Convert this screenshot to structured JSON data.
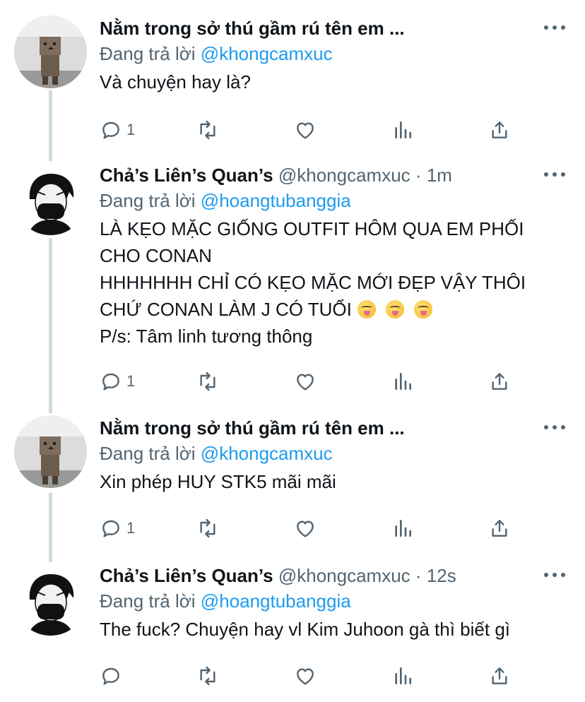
{
  "tweets": [
    {
      "name": "Nằm trong sở thú gầm rú tên em ...",
      "handle": "",
      "time": "",
      "reply_prefix": "Đang trả lời",
      "reply_mention": "@khongcamxuc",
      "lines": [
        "Và chuyện hay là?"
      ],
      "reply_count": "1",
      "avatar": "danbo-avatar"
    },
    {
      "name": "Chả’s Liên’s Quan’s",
      "handle": "@khongcamxuc",
      "time": "1m",
      "reply_prefix": "Đang trả lời",
      "reply_mention": "@hoangtubanggia",
      "lines": [
        "LÀ KẸO MẶC GIỐNG OUTFIT HÔM QUA EM PHỐI",
        "CHO CONAN",
        "HHHHHHH CHỈ CÓ KẸO MẶC MỚI ĐẸP VẬY THÔI",
        "CHỨ CONAN LÀM J CÓ TUỔI",
        "P/s: Tâm linh tương thông"
      ],
      "emojis": [
        "zany-face",
        "zany-face",
        "zany-face"
      ],
      "reply_count": "1",
      "avatar": "masked-boy-avatar"
    },
    {
      "name": "Nằm trong sở thú gầm rú tên em ...",
      "handle": "",
      "time": "",
      "reply_prefix": "Đang trả lời",
      "reply_mention": "@khongcamxuc",
      "lines": [
        "Xin phép HUY STK5 mãi mãi"
      ],
      "reply_count": "1",
      "avatar": "danbo-avatar"
    },
    {
      "name": "Chả’s Liên’s Quan’s",
      "handle": "@khongcamxuc",
      "time": "12s",
      "reply_prefix": "Đang trả lời",
      "reply_mention": "@hoangtubanggia",
      "lines": [
        "The fuck? Chuyện hay vl Kim Juhoon gà thì biết gì"
      ],
      "reply_count": "",
      "avatar": "masked-boy-avatar"
    }
  ],
  "dot_separator": "·",
  "colors": {
    "link": "#1d9bf0",
    "secondary": "#536471",
    "text": "#0f1419",
    "thread_line": "#cfd9de"
  }
}
